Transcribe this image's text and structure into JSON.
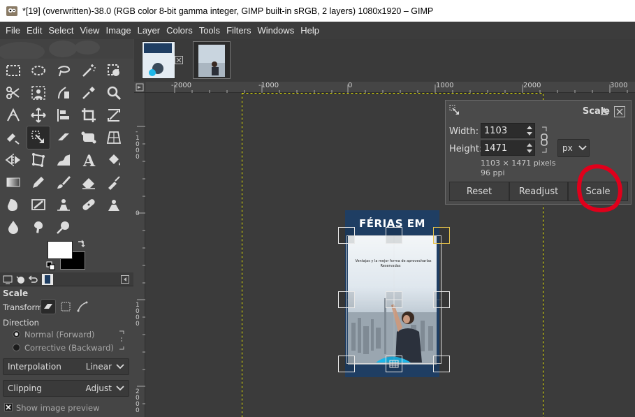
{
  "window": {
    "title": "*[19] (overwritten)-38.0 (RGB color 8-bit gamma integer, GIMP built-in sRGB, 2 layers) 1080x1920 – GIMP"
  },
  "menubar": {
    "items": [
      "File",
      "Edit",
      "Select",
      "View",
      "Image",
      "Layer",
      "Colors",
      "Tools",
      "Filters",
      "Windows",
      "Help"
    ]
  },
  "ruler": {
    "h_labels": [
      "-2000",
      "-1000",
      "0",
      "1000",
      "2000",
      "3000"
    ],
    "v_labels": [
      "-1000",
      "0",
      "1000",
      "2000"
    ]
  },
  "canvas_image": {
    "headline": "FÉRIAS EM",
    "caption_line1": "Ventajas y la mejor forma de aprovecharlas",
    "caption_line2": "Reservadas"
  },
  "scale_dialog": {
    "title": "Scale",
    "width_label": "Width:",
    "width_value": "1103",
    "height_label": "Height:",
    "height_value": "1471",
    "unit": "px",
    "pixels_info": "1103 × 1471 pixels",
    "ppi_info": "96 ppi",
    "reset_label": "Reset",
    "readjust_label": "Readjust",
    "scale_label": "Scale"
  },
  "tool_options": {
    "title": "Scale",
    "transform_label": "Transform:",
    "direction_label": "Direction",
    "direction_normal": "Normal (Forward)",
    "direction_corrective": "Corrective (Backward)",
    "interpolation_label": "Interpolation",
    "interpolation_value": "Linear",
    "clipping_label": "Clipping",
    "clipping_value": "Adjust",
    "preview_label": "Show image preview"
  },
  "colors": {
    "annotation_red": "#e0001b",
    "guide_yellow": "#e6e600",
    "poster_blue": "#1f3e63"
  }
}
